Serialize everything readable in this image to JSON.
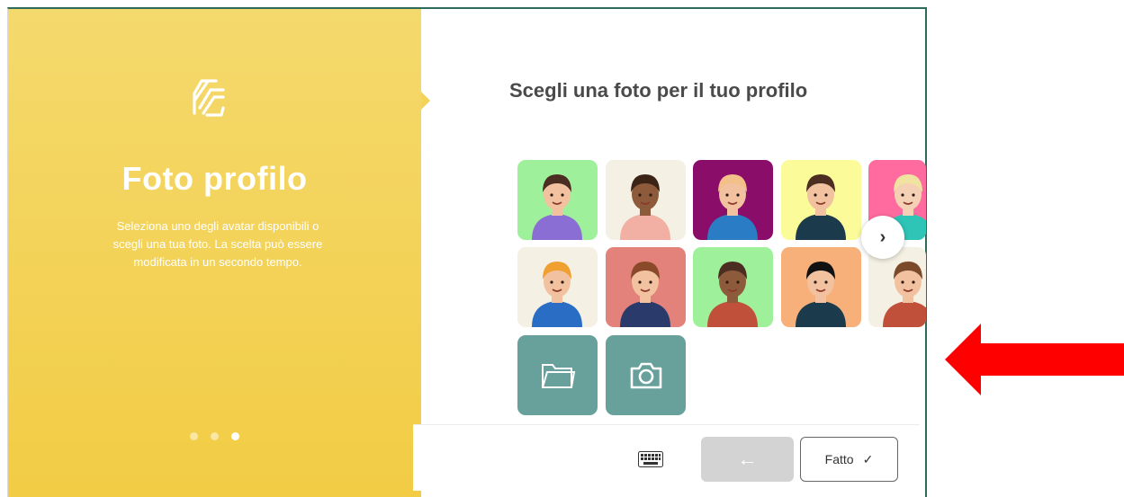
{
  "left": {
    "title": "Foto profilo",
    "description": "Seleziona uno degli avatar disponibili o scegli una tua foto. La scelta può essere modificata in un secondo tempo.",
    "steps_total": 3,
    "active_step": 3
  },
  "main": {
    "heading": "Scegli una foto per il tuo profilo",
    "avatars": [
      {
        "name": "avatar-1",
        "bg": "#9ff09a",
        "skin": "#f2c2a0",
        "hair": "#4b2d22",
        "shirt": "#8b6ed4"
      },
      {
        "name": "avatar-2",
        "bg": "#f4f0e3",
        "skin": "#8d5a3c",
        "hair": "#3b2416",
        "shirt": "#f2b0a5"
      },
      {
        "name": "avatar-3",
        "bg": "#8b0d6a",
        "skin": "#f2c2a0",
        "hair": "#f4c08a",
        "shirt": "#2a7dc4"
      },
      {
        "name": "avatar-4",
        "bg": "#fbfb9a",
        "skin": "#f2c2a0",
        "hair": "#4b2d22",
        "shirt": "#1b3a4b"
      },
      {
        "name": "avatar-5",
        "bg": "#ff6b9f",
        "skin": "#f4d1b4",
        "hair": "#f0e3a0",
        "shirt": "#2ec4b6"
      },
      {
        "name": "avatar-6",
        "bg": "#f4f0e3",
        "skin": "#f2c2a0",
        "hair": "#f0a030",
        "shirt": "#2a6dc4"
      },
      {
        "name": "avatar-7",
        "bg": "#e3827a",
        "skin": "#f2c2a0",
        "hair": "#8a4a2a",
        "shirt": "#2a3a6a"
      },
      {
        "name": "avatar-8",
        "bg": "#9ff09a",
        "skin": "#8d5a3c",
        "hair": "#4b2d22",
        "shirt": "#c0503a"
      },
      {
        "name": "avatar-9",
        "bg": "#f7b07a",
        "skin": "#f2c2a0",
        "hair": "#111111",
        "shirt": "#1b3a4b"
      },
      {
        "name": "avatar-10",
        "bg": "#f4f0e3",
        "skin": "#f2c2a0",
        "hair": "#7a4a2a",
        "shirt": "#c0503a"
      }
    ],
    "actions": [
      {
        "name": "folder-icon",
        "label": "folder"
      },
      {
        "name": "camera-icon",
        "label": "camera"
      }
    ]
  },
  "footer": {
    "keyboard_icon": "keyboard-icon",
    "back_label": "←",
    "done_label": "Fatto",
    "done_icon": "✓"
  },
  "colors": {
    "accent_yellow": "#f2cc44",
    "teal": "#68a09b",
    "annotation_red": "#ff0000"
  }
}
